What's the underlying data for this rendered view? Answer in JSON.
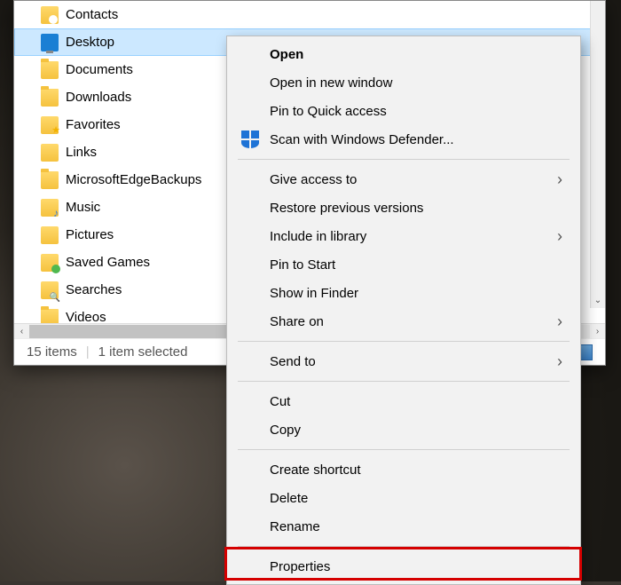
{
  "folders": [
    {
      "label": "Contacts",
      "iconClass": "contacts-icon",
      "selected": false
    },
    {
      "label": "Desktop",
      "iconClass": "desktop-icon",
      "selected": true
    },
    {
      "label": "Documents",
      "iconClass": "folder-icon",
      "selected": false
    },
    {
      "label": "Downloads",
      "iconClass": "folder-icon",
      "selected": false
    },
    {
      "label": "Favorites",
      "iconClass": "favorites-icon",
      "selected": false
    },
    {
      "label": "Links",
      "iconClass": "links-icon",
      "selected": false
    },
    {
      "label": "MicrosoftEdgeBackups",
      "iconClass": "folder-icon",
      "selected": false
    },
    {
      "label": "Music",
      "iconClass": "music-icon",
      "selected": false
    },
    {
      "label": "Pictures",
      "iconClass": "pictures-icon",
      "selected": false
    },
    {
      "label": "Saved Games",
      "iconClass": "savedgames-icon",
      "selected": false
    },
    {
      "label": "Searches",
      "iconClass": "searches-icon",
      "selected": false
    },
    {
      "label": "Videos",
      "iconClass": "folder-icon",
      "selected": false
    }
  ],
  "status": {
    "items_count": "15 items",
    "selection": "1 item selected"
  },
  "context_menu": [
    {
      "type": "item",
      "label": "Open",
      "bold": true
    },
    {
      "type": "item",
      "label": "Open in new window"
    },
    {
      "type": "item",
      "label": "Pin to Quick access"
    },
    {
      "type": "item",
      "label": "Scan with Windows Defender...",
      "icon": "defender-icon"
    },
    {
      "type": "sep"
    },
    {
      "type": "item",
      "label": "Give access to",
      "submenu": true
    },
    {
      "type": "item",
      "label": "Restore previous versions"
    },
    {
      "type": "item",
      "label": "Include in library",
      "submenu": true
    },
    {
      "type": "item",
      "label": "Pin to Start"
    },
    {
      "type": "item",
      "label": "Show in Finder"
    },
    {
      "type": "item",
      "label": "Share on",
      "submenu": true
    },
    {
      "type": "sep"
    },
    {
      "type": "item",
      "label": "Send to",
      "submenu": true
    },
    {
      "type": "sep"
    },
    {
      "type": "item",
      "label": "Cut"
    },
    {
      "type": "item",
      "label": "Copy"
    },
    {
      "type": "sep"
    },
    {
      "type": "item",
      "label": "Create shortcut"
    },
    {
      "type": "item",
      "label": "Delete"
    },
    {
      "type": "item",
      "label": "Rename"
    },
    {
      "type": "sep"
    },
    {
      "type": "item",
      "label": "Properties",
      "highlight": true
    }
  ]
}
